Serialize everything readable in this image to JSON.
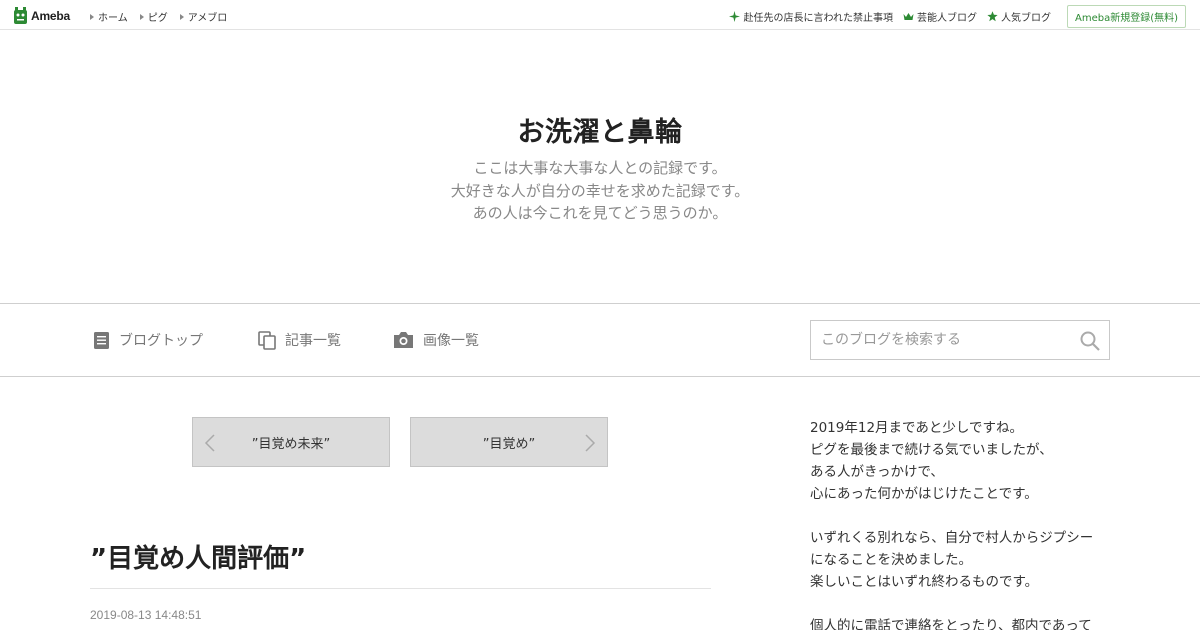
{
  "topbar": {
    "logo_text": "Ameba",
    "nav": [
      {
        "label": "ホーム"
      },
      {
        "label": "ピグ"
      },
      {
        "label": "アメブロ"
      }
    ],
    "right_links": [
      {
        "label": "赴任先の店長に言われた禁止事項",
        "icon": "sparkle-icon"
      },
      {
        "label": "芸能人ブログ",
        "icon": "crown-icon"
      },
      {
        "label": "人気ブログ",
        "icon": "star-icon"
      }
    ],
    "register_label": "Ameba新規登録(無料)",
    "accent_color": "#2d8a34"
  },
  "header": {
    "title": "お洗濯と鼻輪",
    "description": [
      "ここは大事な大事な人との記録です。",
      "大好きな人が自分の幸せを求めた記録です。",
      "あの人は今これを見てどう思うのか。"
    ]
  },
  "blog_nav": {
    "items": [
      {
        "label": "ブログトップ",
        "icon": "document-icon"
      },
      {
        "label": "記事一覧",
        "icon": "copy-icon"
      },
      {
        "label": "画像一覧",
        "icon": "camera-icon"
      }
    ],
    "search": {
      "placeholder": "このブログを検索する",
      "value": ""
    }
  },
  "pager": {
    "prev_label": "”目覚め未来”",
    "next_label": "”目覚め”"
  },
  "article": {
    "title": "”目覚め人間評価”",
    "date": "2019-08-13 14:48:51"
  },
  "sidebar": {
    "text": "2019年12月まであと少しですね。\nピグを最後まで続ける気でいましたが、\nある人がきっかけで、\n心にあった何かがはじけたことです。\n\nいずれくる別れなら、自分で村人からジプシー\nになることを決めました。\n楽しいことはいずれ終わるものです。\n\n個人的に電話で連絡をとったり、都内であって"
  }
}
